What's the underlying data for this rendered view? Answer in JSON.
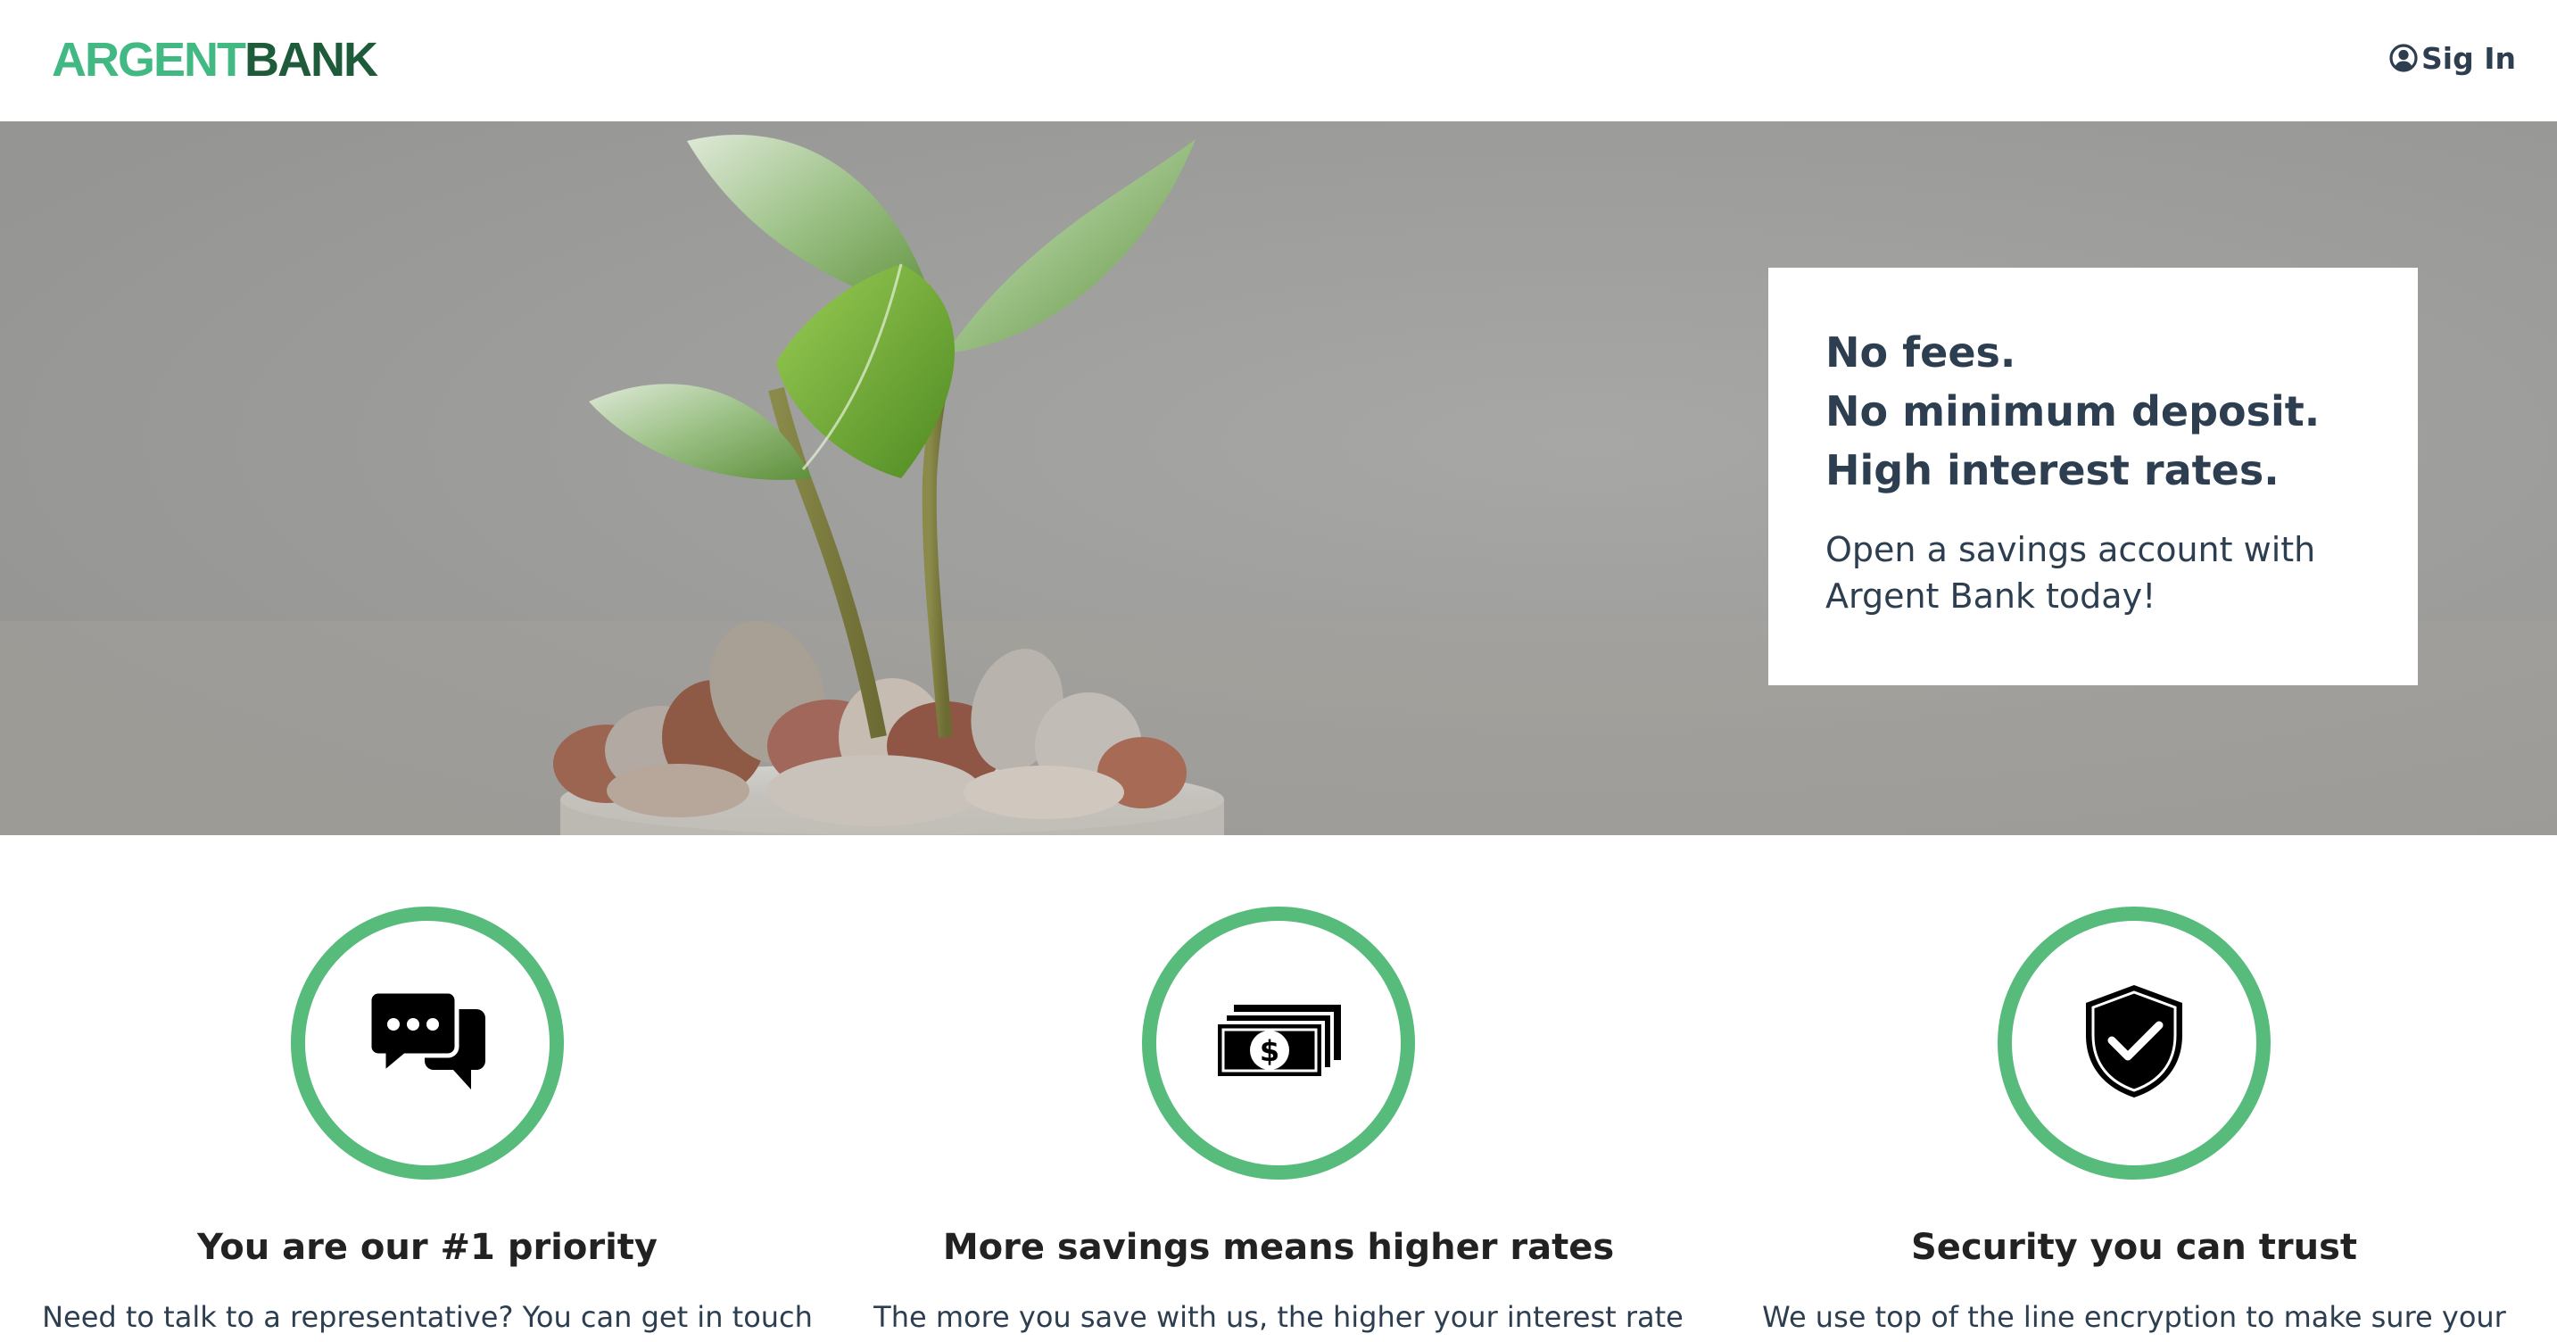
{
  "header": {
    "logo_part1": "ARGENT",
    "logo_part2": "BANK",
    "signin_label": "Sig In",
    "signin_icon": "user-circle-icon"
  },
  "hero": {
    "headline_lines": [
      "No fees.",
      "No minimum deposit.",
      "High interest rates."
    ],
    "subtitle": "Open a savings account with Argent Bank today!",
    "image": "plant-growing-from-coins"
  },
  "features": [
    {
      "icon": "chat-bubbles-icon",
      "title": "You are our #1 priority",
      "description": "Need to talk to a representative? You can get in touch"
    },
    {
      "icon": "money-bills-icon",
      "title": "More savings means higher rates",
      "description": "The more you save with us, the higher your interest rate"
    },
    {
      "icon": "shield-check-icon",
      "title": "Security you can trust",
      "description": "We use top of the line encryption to make sure your"
    }
  ],
  "colors": {
    "brand_green": "#42b983",
    "brand_dark_green": "#1e5b3a",
    "feature_ring": "#57bb7c",
    "text": "#2c3e50"
  }
}
